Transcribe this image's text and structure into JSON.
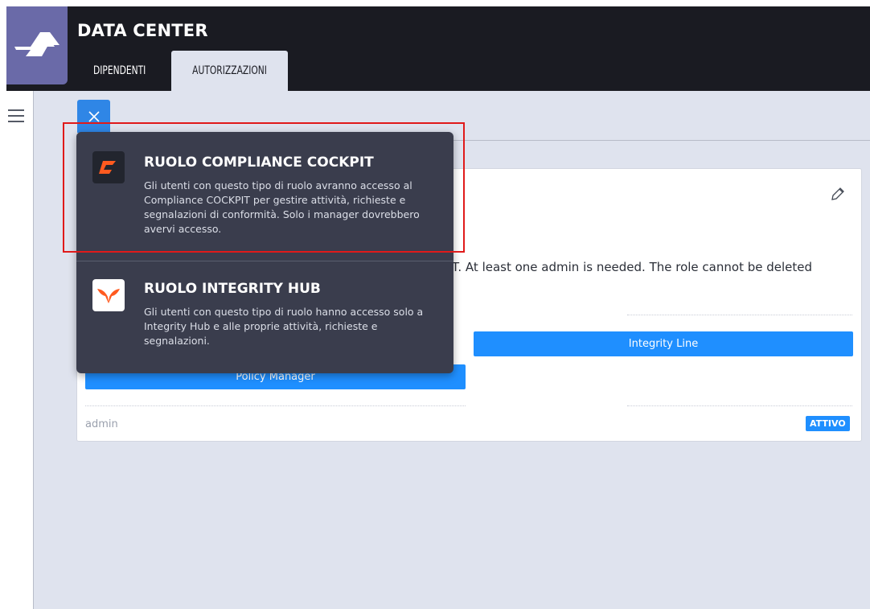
{
  "header": {
    "app_title": "DATA CENTER",
    "tabs": [
      {
        "label": "DIPENDENTI",
        "active": false
      },
      {
        "label": "AUTORIZZAZIONI",
        "active": true
      }
    ]
  },
  "icons": {
    "logo": "data-center-logo-icon",
    "menu": "hamburger-menu-icon",
    "close": "close-icon",
    "edit": "pencil-icon"
  },
  "card": {
    "description": "T. At least one admin is needed. The role cannot be deleted",
    "apps": [
      "Integrity Line",
      "Policy Manager"
    ],
    "footer_label": "admin",
    "status_badge": "ATTIVO"
  },
  "role_menu": {
    "items": [
      {
        "title": "RUOLO COMPLIANCE COCKPIT",
        "description": "Gli utenti con questo tipo di ruolo avranno accesso al Compliance COCKPIT per gestire attività, richieste e segnalazioni di conformità. Solo i manager dovrebbero avervi accesso.",
        "icon": "compliance-cockpit-icon",
        "highlighted": true
      },
      {
        "title": "RUOLO INTEGRITY HUB",
        "description": "Gli utenti con questo tipo di ruolo hanno accesso solo a Integrity Hub e alle proprie attività, richieste e segnalazioni.",
        "icon": "integrity-hub-icon",
        "highlighted": false
      }
    ]
  },
  "colors": {
    "topbar": "#1a1b22",
    "accent_blue": "#1f8fff",
    "menu_bg": "#3a3d4d",
    "highlight_red": "#e01a1a",
    "cockpit_orange": "#ff5a1f"
  }
}
